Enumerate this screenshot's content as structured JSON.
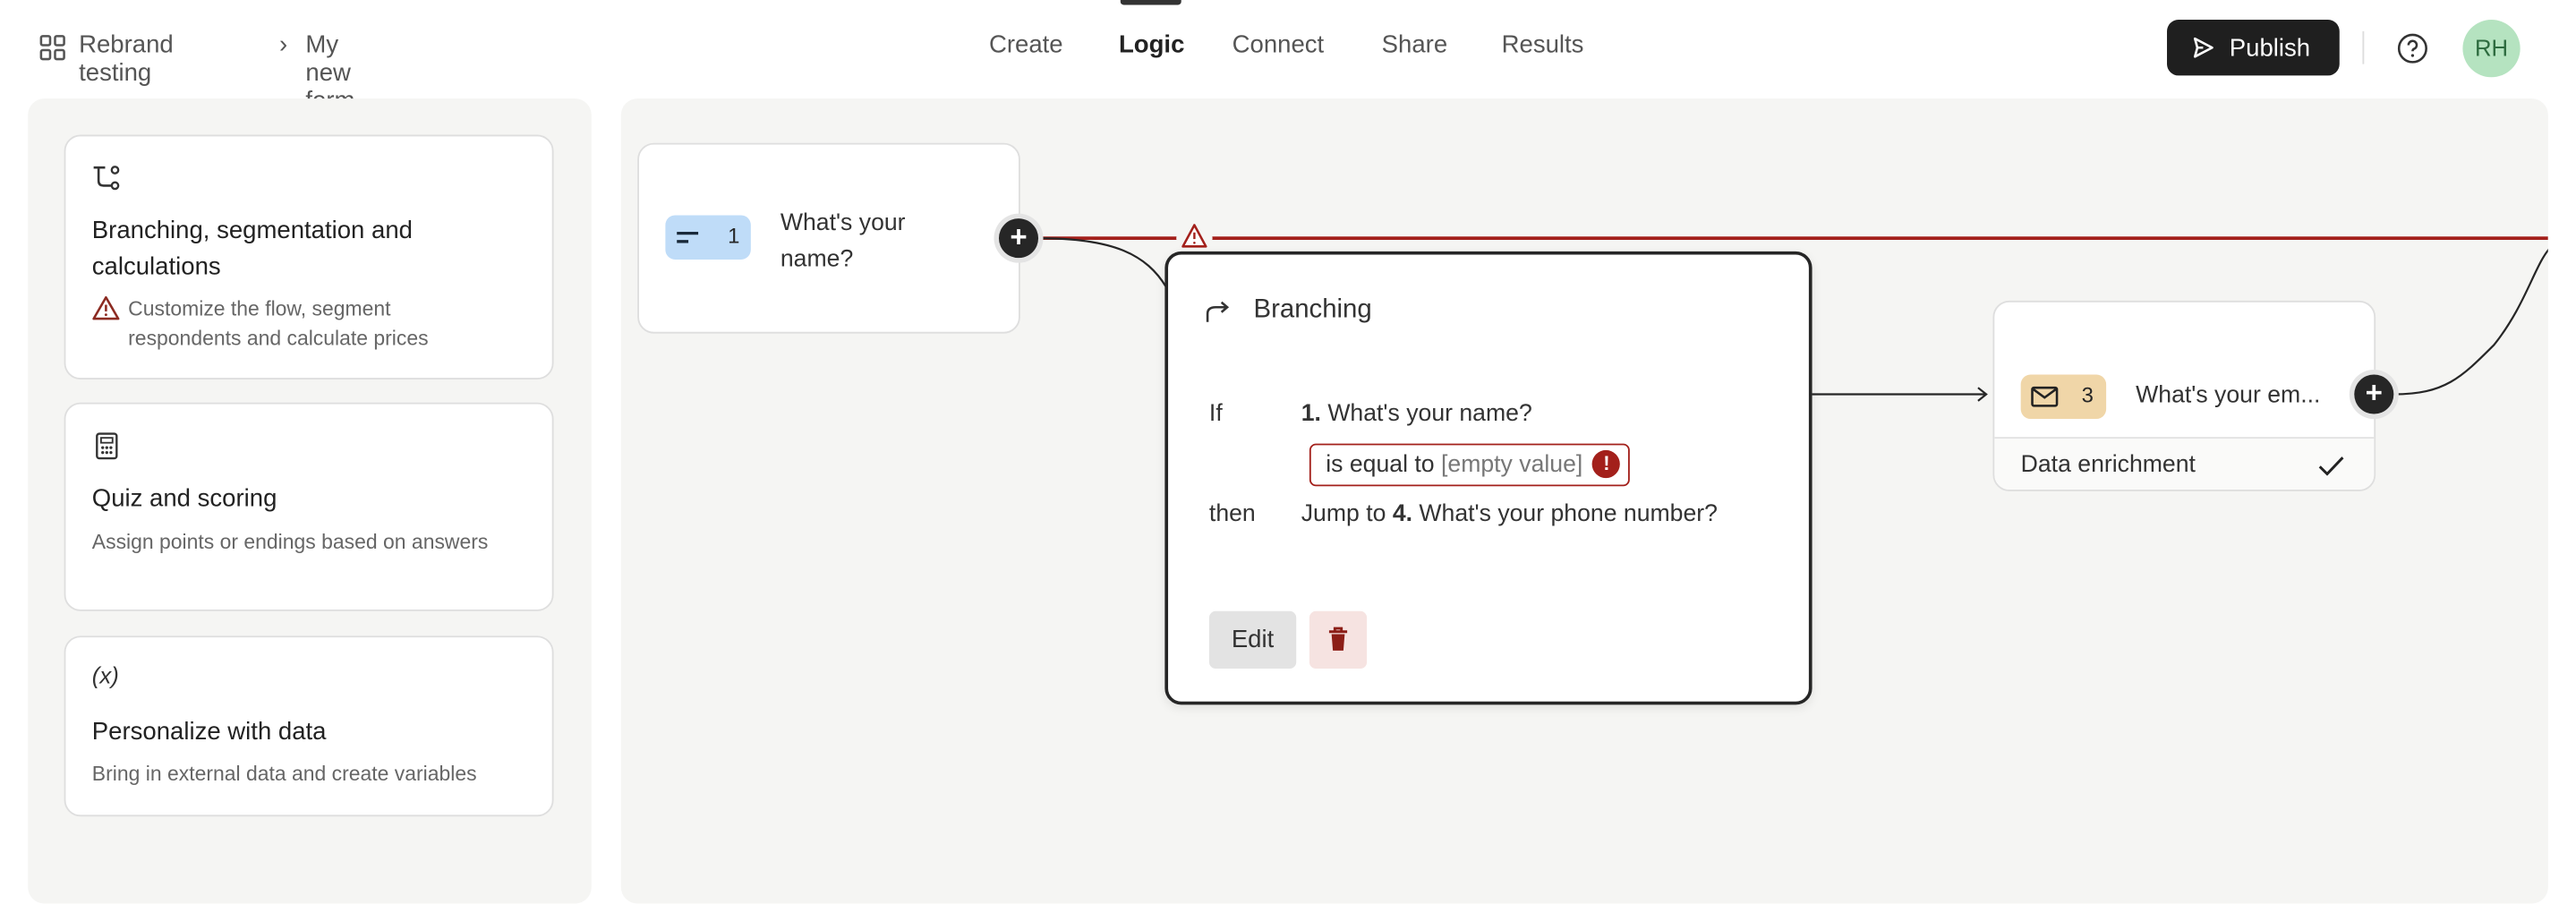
{
  "header": {
    "breadcrumb": {
      "workspace": "Rebrand testing",
      "separator": "›",
      "form": "My new form"
    },
    "nav": [
      {
        "label": "Create"
      },
      {
        "label": "Logic",
        "active": true
      },
      {
        "label": "Connect"
      },
      {
        "label": "Share"
      },
      {
        "label": "Results"
      }
    ],
    "publish_label": "Publish",
    "help_icon": "question-circle-icon",
    "avatar_initials": "RH"
  },
  "sidebar": {
    "cards": [
      {
        "icon": "branch-icon",
        "title": "Branching, segmentation and calculations",
        "description": "Customize the flow, segment respondents and calculate prices",
        "warning": true
      },
      {
        "icon": "calculator-icon",
        "title": "Quiz and scoring",
        "description": "Assign points or endings based on answers"
      },
      {
        "icon": "variable-icon",
        "title": "Personalize with data",
        "description": "Bring in external data and create variables"
      }
    ]
  },
  "canvas": {
    "nodes": [
      {
        "number": "1",
        "title": "What's your name?",
        "icon": "short-text-icon",
        "badge_color": "#bfdcf8"
      },
      {
        "number": "3",
        "title": "What's your em...",
        "icon": "email-icon",
        "badge_color": "#f0d6a8",
        "footer": "Data enrichment"
      }
    ],
    "popup": {
      "title": "Branching",
      "if_label": "If",
      "if_question_num": "1.",
      "if_question": "What's your name?",
      "condition_op": "is equal to",
      "condition_value": "[empty value]",
      "then_label": "then",
      "then_prefix": "Jump to",
      "then_num": "4.",
      "then_question": "What's your phone number?",
      "edit_label": "Edit"
    },
    "colors": {
      "error": "#a3201b",
      "dark": "#262626"
    }
  }
}
